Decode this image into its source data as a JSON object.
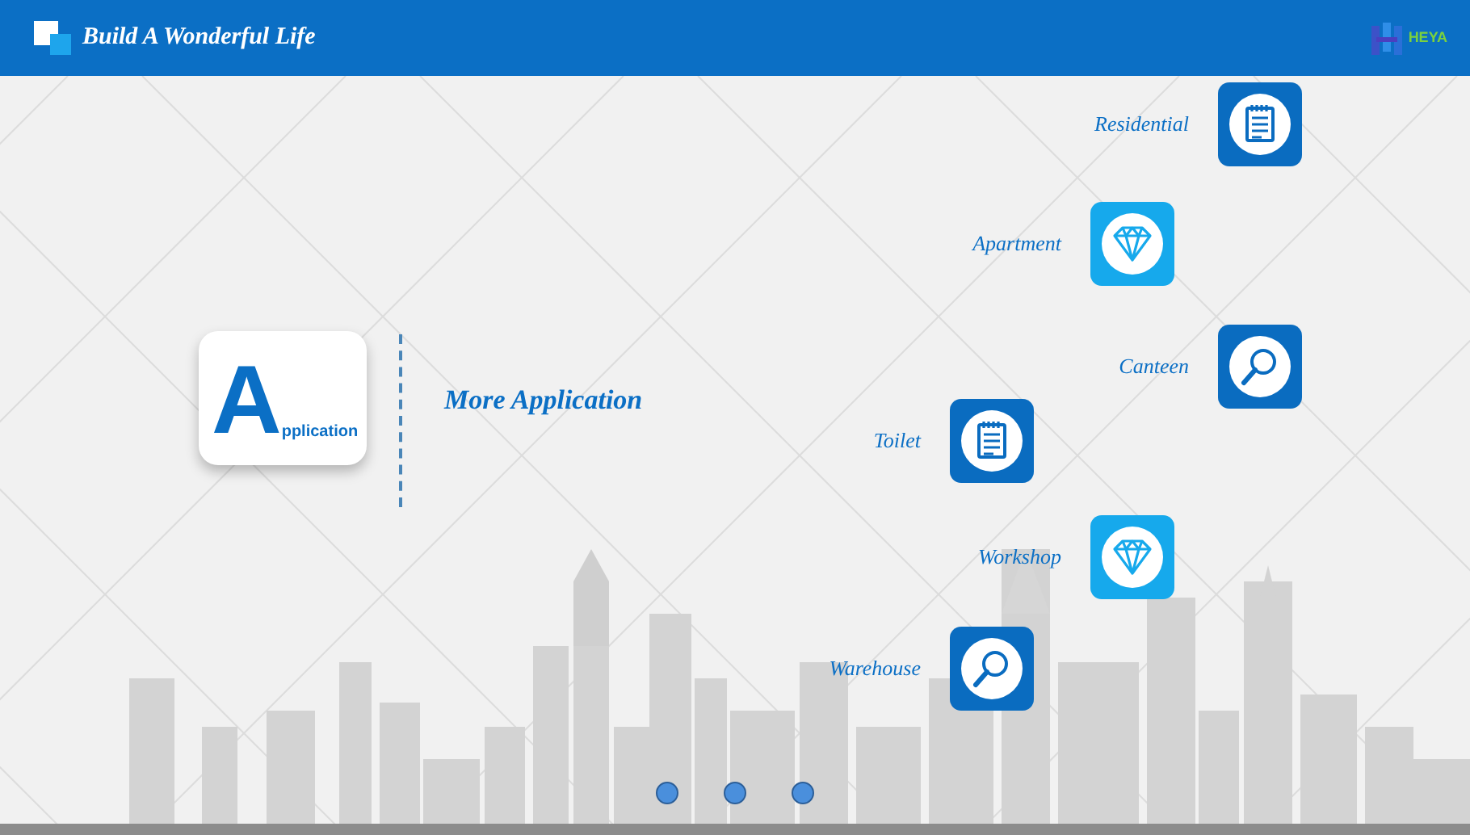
{
  "header": {
    "title": "Build A Wonderful Life",
    "logo_text": "HEYA"
  },
  "feature": {
    "initial": "A",
    "rest": "pplication",
    "heading": "More Application"
  },
  "items": [
    {
      "label": "Residential",
      "kind": "notepad",
      "color": "#0a6cc0"
    },
    {
      "label": "Apartment",
      "kind": "diamond",
      "color": "#16a9ec"
    },
    {
      "label": "Canteen",
      "kind": "search",
      "color": "#0a6cc0"
    },
    {
      "label": "Toilet",
      "kind": "notepad",
      "color": "#0a6cc0"
    },
    {
      "label": "Workshop",
      "kind": "diamond",
      "color": "#16a9ec"
    },
    {
      "label": "Warehouse",
      "kind": "search",
      "color": "#0a6cc0"
    }
  ]
}
